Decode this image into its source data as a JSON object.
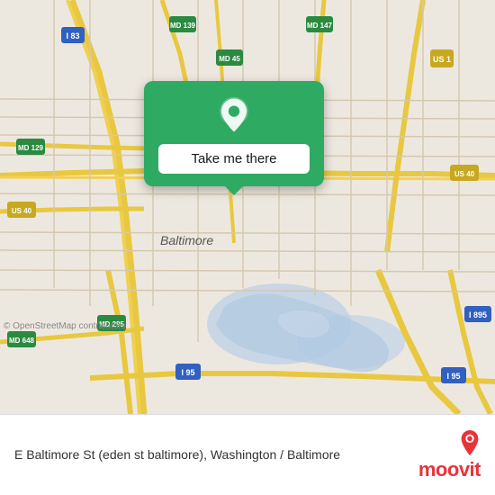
{
  "map": {
    "background_color": "#e8e4dc",
    "water_color": "#b8d4e8",
    "road_color": "#f5c842",
    "highway_color": "#f5c842",
    "osm_credit": "© OpenStreetMap contributors"
  },
  "popup": {
    "button_label": "Take me there",
    "background_color": "#2eaa62",
    "pin_icon": "location-pin"
  },
  "info_bar": {
    "title": "E Baltimore St (eden st baltimore), Washington / Baltimore"
  },
  "branding": {
    "name": "moovit"
  }
}
